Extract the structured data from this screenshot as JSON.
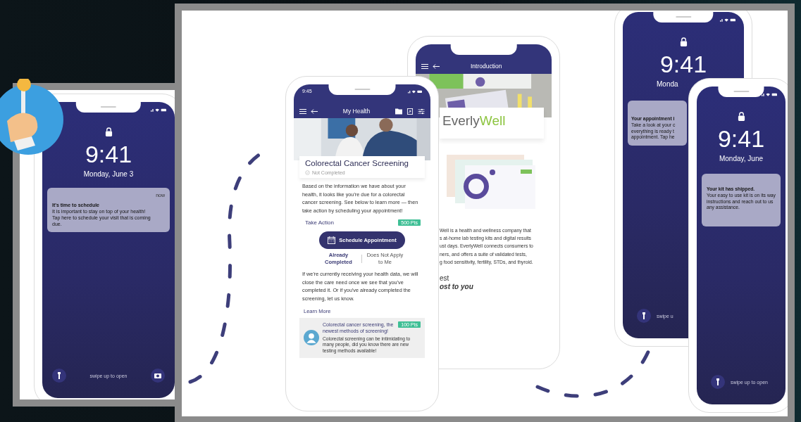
{
  "lock_screens": [
    {
      "time": "9:41",
      "date": "Monday, June 3",
      "notification": {
        "age": "now",
        "title": "It's time to schedule",
        "lines": [
          "It is important to stay on top of your health!",
          "Tap here to schedule your visit that is coming",
          "due."
        ]
      },
      "hint": "swipe up to open",
      "camera": true
    },
    {
      "time": "9:41",
      "date": "Monda",
      "notification": {
        "title": "Your appointment i",
        "lines": [
          "Take a look at your c",
          "everything is ready t",
          "appointment. Tap he"
        ]
      },
      "hint": "swipe u",
      "camera": false
    },
    {
      "time": "9:41",
      "date": "Monday, June",
      "notification": {
        "title": "Your kit has shipped.",
        "lines": [
          "Your easy to use kit is on its way",
          "instructions and reach out to us",
          "any assistance."
        ]
      },
      "hint": "swipe up to open",
      "camera": false
    }
  ],
  "intro_screen": {
    "title": "Introduction",
    "logo": {
      "first": "Everly",
      "second": "Well"
    },
    "lines": [
      "Well is a health and wellness company that",
      "s at-home lab testing kits and digital results",
      "ust days. EverlyWell connects consumers to",
      "ners, and offers a suite of validated tests,",
      "g food sensitivity, fertility, STDs, and thyroid."
    ],
    "heading_lines": [
      "est",
      "ost to you"
    ]
  },
  "health_screen": {
    "status_time": "9:45",
    "title": "My Health",
    "card_title": "Colorectal Cancer Screening",
    "status": "Not Completed",
    "intro": "Based on the information we have about your health, it looks like you're due for a colorectal cancer screening. See below to learn more — then take action by scheduling your appointment!",
    "section": "Take Action",
    "section_points": "500 Pts",
    "primary_button": "Schedule Appointment",
    "options": [
      {
        "label": "Already Completed",
        "selected": true
      },
      {
        "label": "Does Not Apply to Me",
        "selected": false
      }
    ],
    "note": "If we're currently receiving your health data, we will close the care need once we see that you've completed it.  Or if you've already completed the screening, let us know.",
    "link": "Learn More",
    "article": {
      "title": "Colorectal cancer screening, the newest methods of screening!",
      "points": "100 Pts",
      "body": "Colorectal screening can be intimidating to many people, did you know there are new testing methods available!"
    }
  }
}
